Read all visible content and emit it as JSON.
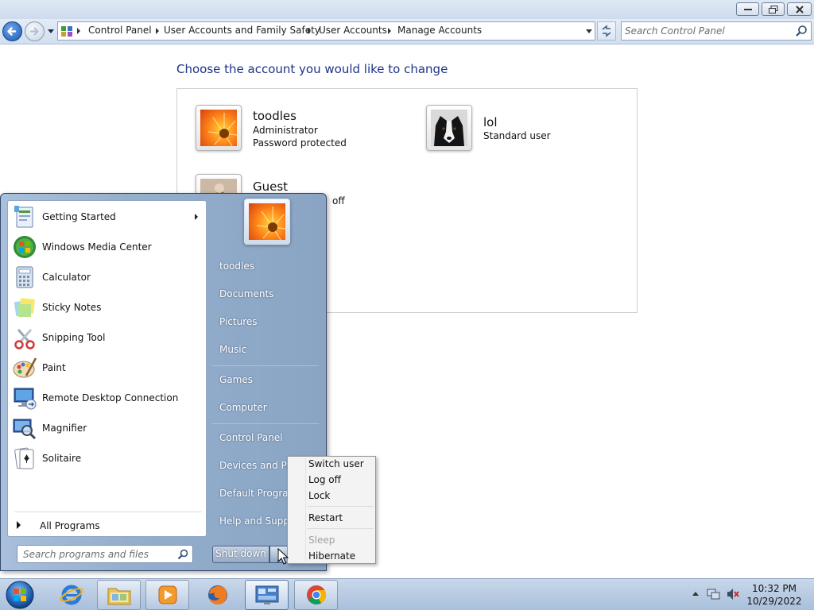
{
  "window": {
    "breadcrumbs": [
      "Control Panel",
      "User Accounts and Family Safety",
      "User Accounts",
      "Manage Accounts"
    ],
    "search_placeholder": "Search Control Panel"
  },
  "content": {
    "title": "Choose the account you would like to change",
    "accounts": [
      {
        "name": "toodles",
        "lines": [
          "Administrator",
          "Password protected"
        ],
        "picture": "flower-icon"
      },
      {
        "name": "lol",
        "lines": [
          "Standard user"
        ],
        "picture": "dog-icon"
      },
      {
        "name": "Guest",
        "lines": [
          "off"
        ],
        "picture": "guest-icon"
      }
    ]
  },
  "start_menu": {
    "programs": [
      {
        "label": "Getting Started",
        "icon": "getting-started-icon"
      },
      {
        "label": "Windows Media Center",
        "icon": "media-center-icon"
      },
      {
        "label": "Calculator",
        "icon": "calculator-icon"
      },
      {
        "label": "Sticky Notes",
        "icon": "sticky-notes-icon"
      },
      {
        "label": "Snipping Tool",
        "icon": "scissors-icon"
      },
      {
        "label": "Paint",
        "icon": "paint-palette-icon"
      },
      {
        "label": "Remote Desktop Connection",
        "icon": "remote-desktop-icon"
      },
      {
        "label": "Magnifier",
        "icon": "magnifier-icon"
      },
      {
        "label": "Solitaire",
        "icon": "cards-icon"
      }
    ],
    "all_programs": "All Programs",
    "search_placeholder": "Search programs and files",
    "right_links": [
      "toodles",
      "Documents",
      "Pictures",
      "Music",
      "Games",
      "Computer",
      "Control Panel",
      "Devices and Prin",
      "Default Program",
      "Help and Suppo"
    ],
    "shutdown_label": "Shut down"
  },
  "power_menu": {
    "items": [
      {
        "label": "Switch user",
        "enabled": true
      },
      {
        "label": "Log off",
        "enabled": true
      },
      {
        "label": "Lock",
        "enabled": true
      },
      {
        "label": "Restart",
        "enabled": true
      },
      {
        "label": "Sleep",
        "enabled": false
      },
      {
        "label": "Hibernate",
        "enabled": true
      }
    ]
  },
  "taskbar": {
    "apps": [
      "start-orb-icon",
      "internet-explorer-icon",
      "folder-icon",
      "media-player-icon",
      "firefox-icon",
      "control-panel-icon",
      "chrome-icon"
    ],
    "clock_time": "10:32 PM",
    "clock_date": "10/29/2022"
  },
  "colors": {
    "title_blue": "#1e3287",
    "start_menu_blue": "#94aecd",
    "taskbar": "#bfd0e6"
  }
}
